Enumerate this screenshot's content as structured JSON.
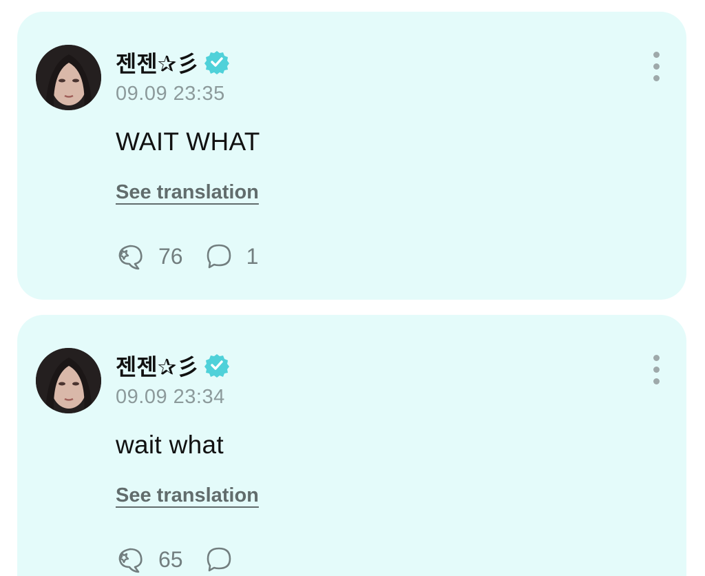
{
  "posts": [
    {
      "author": "젠젠✰彡",
      "timestamp": "09.09 23:35",
      "text": "WAIT WHAT",
      "translation_label": "See translation",
      "like_count": "76",
      "comment_count": "1"
    },
    {
      "author": "젠젠✰彡",
      "timestamp": "09.09 23:34",
      "text": "wait what",
      "translation_label": "See translation",
      "like_count": "65",
      "comment_count": ""
    }
  ],
  "icons": {
    "verified": "verified-badge-icon",
    "more": "more-vertical-icon",
    "like": "cheer-bubble-icon",
    "comment": "comment-icon"
  },
  "colors": {
    "card_background": "#e4fbfa",
    "verified_badge": "#4fd1d9",
    "timestamp": "#8c9a9b",
    "muted_icon": "#727e7f"
  }
}
